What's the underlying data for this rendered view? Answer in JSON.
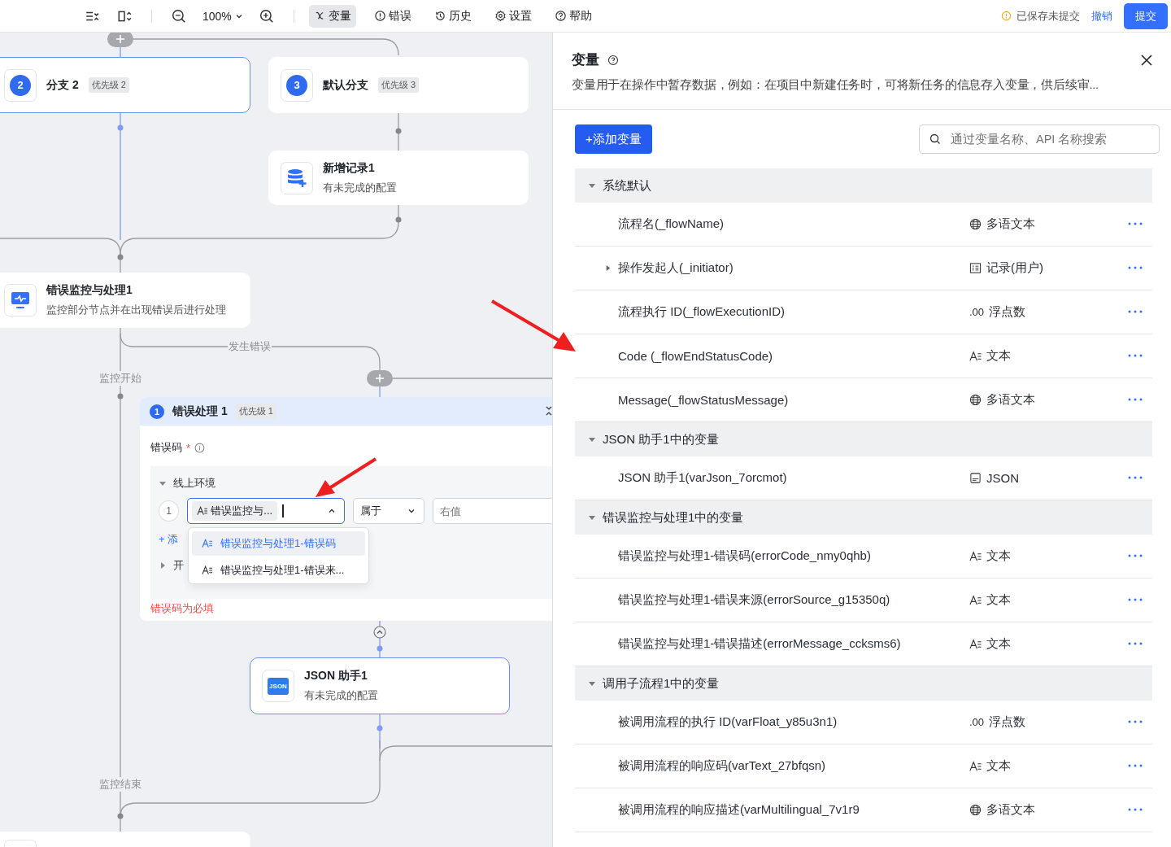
{
  "toolbar": {
    "zoom": "100%",
    "tools": [
      {
        "label": "变量",
        "selected": true
      },
      {
        "label": "错误",
        "selected": false
      },
      {
        "label": "历史",
        "selected": false
      },
      {
        "label": "设置",
        "selected": false
      },
      {
        "label": "帮助",
        "selected": false
      }
    ],
    "save_status": "已保存未提交",
    "undo": "撤销",
    "submit": "提交"
  },
  "canvas": {
    "nodes": [
      {
        "kind": "branch",
        "badge": "2",
        "title": "分支 2",
        "tag": "优先级 2",
        "selected": true
      },
      {
        "kind": "branch",
        "badge": "3",
        "title": "默认分支",
        "tag": "优先级 3",
        "selected": false
      },
      {
        "kind": "record",
        "title": "新增记录1",
        "subtitle": "有未完成的配置",
        "selected": false
      },
      {
        "kind": "monitor",
        "title": "错误监控与处理1",
        "subtitle": "监控部分节点并在出现错误后进行处理",
        "selected": false
      },
      {
        "kind": "json",
        "icon_text": "JSON",
        "title": "JSON 助手1",
        "subtitle": "有未完成的配置",
        "selected": true
      },
      {
        "kind": "partial",
        "selected": false
      }
    ],
    "labels": [
      "发生错误",
      "监控开始",
      "监控结束"
    ],
    "error_handler": {
      "badge": "1",
      "title": "错误处理 1",
      "tag": "优先级 1",
      "field_label": "错误码",
      "required_mark": "*",
      "group": {
        "title": "线上环境",
        "expanded": true,
        "index": "1",
        "left_value": "错误监控与...",
        "operator": "属于",
        "right_placeholder": "右值"
      },
      "add_label": "+ 添",
      "second_group": {
        "title": "开",
        "expanded": false
      },
      "dropdown": [
        {
          "label": "错误监控与处理1-错误码",
          "selected": true
        },
        {
          "label": "错误监控与处理1-错误来...",
          "selected": false
        }
      ],
      "error": "错误码为必填"
    }
  },
  "panel": {
    "title": "变量",
    "description": "变量用于在操作中暂存数据，例如：在项目中新建任务时，可将新任务的信息存入变量，供后续审...",
    "add_button": "+添加变量",
    "search": {
      "placeholder": "通过变量名称、API 名称搜索"
    },
    "groups": [
      {
        "title": "系统默认",
        "expanded": true,
        "rows": [
          {
            "name": "流程名(_flowName)",
            "type": "多语文本",
            "kind": "globe"
          },
          {
            "name": "操作发起人(_initiator)",
            "type": "记录(用户)",
            "kind": "record",
            "expanded": false
          },
          {
            "name": "流程执行 ID(_flowExecutionID)",
            "type": "浮点数",
            "kind": "number",
            "icon_text": ".00"
          },
          {
            "name": "Code  (_flowEndStatusCode)",
            "type": "文本",
            "kind": "text"
          },
          {
            "name": "Message(_flowStatusMessage)",
            "type": "多语文本",
            "kind": "globe"
          }
        ]
      },
      {
        "title": "JSON 助手1中的变量",
        "expanded": true,
        "rows": [
          {
            "name": "JSON 助手1(varJson_7orcmot)",
            "type": "JSON",
            "kind": "json"
          }
        ]
      },
      {
        "title": "错误监控与处理1中的变量",
        "expanded": true,
        "rows": [
          {
            "name": "错误监控与处理1-错误码(errorCode_nmy0qhb)",
            "type": "文本",
            "kind": "text"
          },
          {
            "name": "错误监控与处理1-错误来源(errorSource_g15350q)",
            "type": "文本",
            "kind": "text"
          },
          {
            "name": "错误监控与处理1-错误描述(errorMessage_ccksms6)",
            "type": "文本",
            "kind": "text"
          }
        ]
      },
      {
        "title": "调用子流程1中的变量",
        "expanded": true,
        "rows": [
          {
            "name": "被调用流程的执行 ID(varFloat_y85u3n1)",
            "type": "浮点数",
            "kind": "number",
            "icon_text": ".00"
          },
          {
            "name": "被调用流程的响应码(varText_27bfqsn)",
            "type": "文本",
            "kind": "text"
          },
          {
            "name": "被调用流程的响应描述(varMultilingual_7v1r9",
            "type": "多语文本",
            "kind": "globe"
          }
        ]
      }
    ]
  }
}
